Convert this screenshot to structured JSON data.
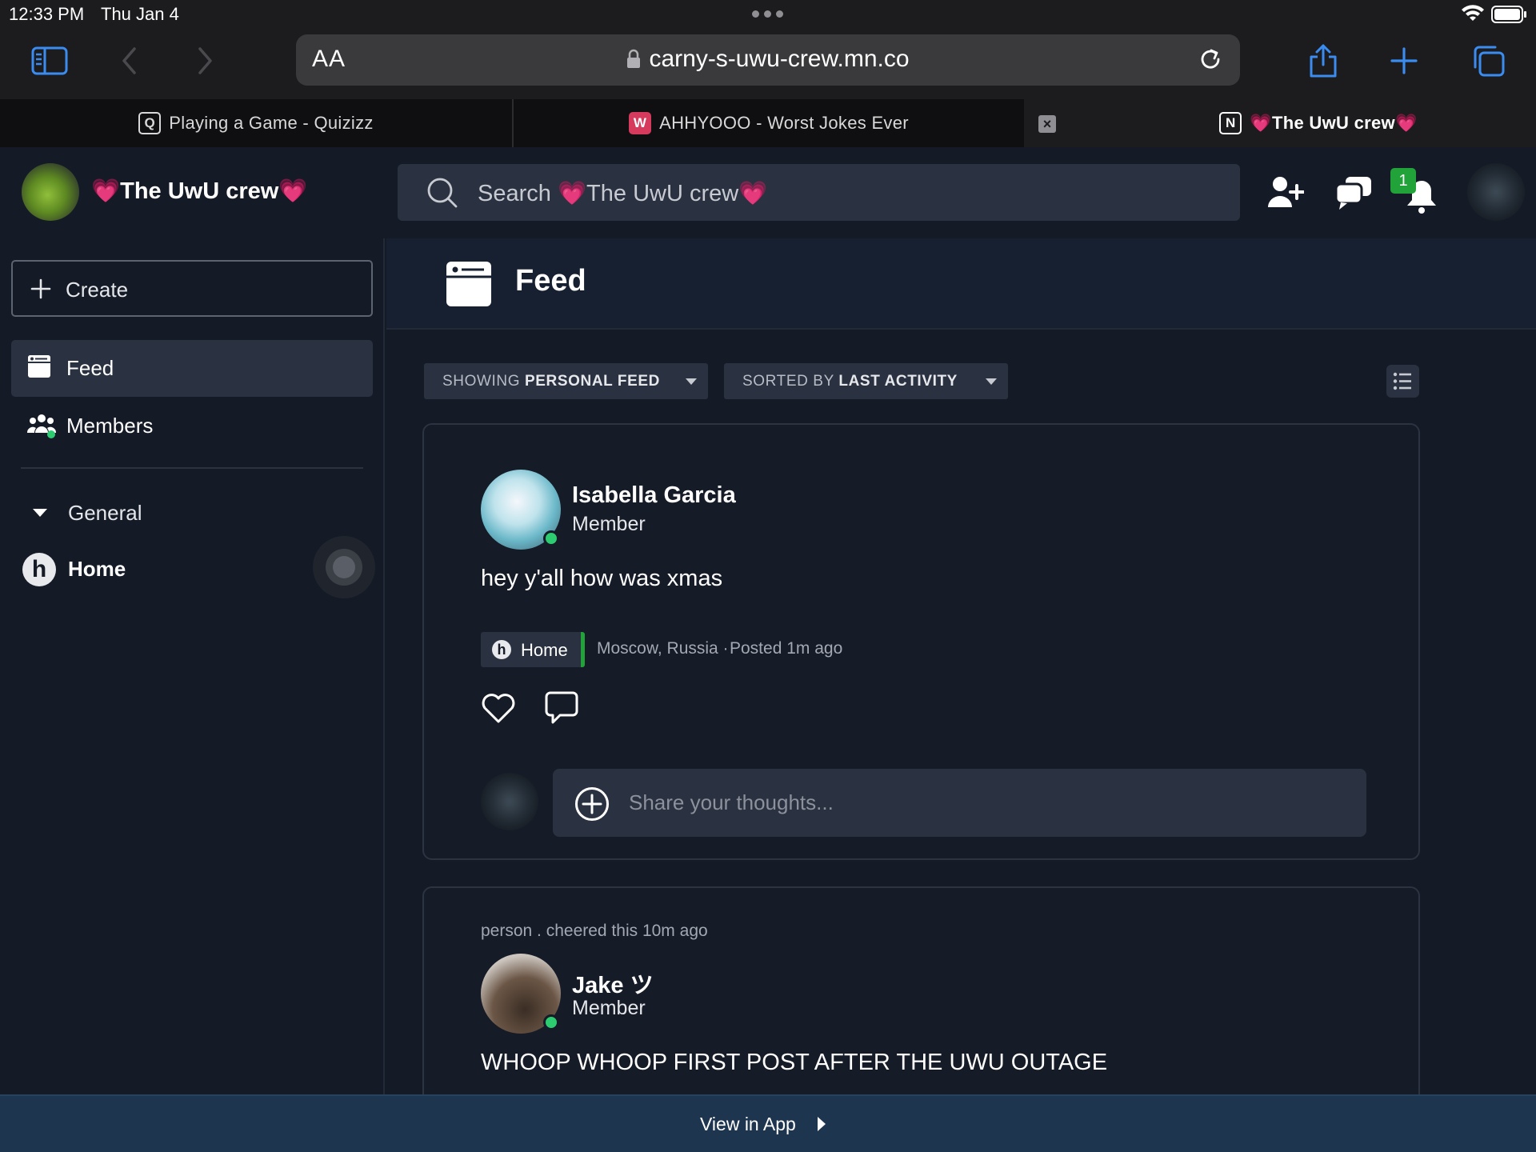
{
  "status_bar": {
    "time": "12:33 PM",
    "date": "Thu Jan 4"
  },
  "browser": {
    "text_size_label": "AA",
    "url": "carny-s-uwu-crew.mn.co",
    "tabs": [
      {
        "favicon": "Q",
        "title": "Playing a Game - Quizizz"
      },
      {
        "favicon": "W",
        "title": "AHHYOOO - Worst Jokes Ever"
      },
      {
        "favicon": "N",
        "title": "💗The UwU crew💗"
      }
    ]
  },
  "header": {
    "community_name": "💗The UwU crew💗",
    "search_placeholder": "Search 💗The UwU crew💗",
    "notification_count": "1"
  },
  "sidebar": {
    "create_label": "Create",
    "nav": [
      {
        "label": "Feed"
      },
      {
        "label": "Members"
      }
    ],
    "section_label": "General",
    "space_icon": "h",
    "space_label": "Home"
  },
  "main": {
    "title": "Feed",
    "filters": {
      "showing_prefix": "SHOWING",
      "showing_value": "PERSONAL FEED",
      "sorted_prefix": "SORTED BY",
      "sorted_value": "LAST ACTIVITY"
    },
    "posts": [
      {
        "author": "Isabella Garcia",
        "role": "Member",
        "body": "hey y'all how was xmas",
        "space_icon": "h",
        "space": "Home",
        "location": "Moscow, Russia ·",
        "posted": "Posted 1m ago",
        "comment_placeholder": "Share your thoughts..."
      },
      {
        "activity": "person . cheered this 10m ago",
        "author": "Jake ツ",
        "role": "Member",
        "body": "WHOOP WHOOP FIRST POST AFTER THE UWU OUTAGE"
      }
    ]
  },
  "banner": {
    "label": "View in App"
  },
  "colors": {
    "accent_blue": "#3b8cf0",
    "online_green": "#2ecc71",
    "space_green": "#21a33a",
    "banner_bg": "#1e3550"
  },
  "icons": [
    "sidebar-icon",
    "back-icon",
    "forward-icon",
    "lock-icon",
    "reload-icon",
    "share-icon",
    "new-tab-icon",
    "tabs-icon",
    "search-icon",
    "add-member-icon",
    "chat-icon",
    "bell-icon",
    "plus-icon",
    "feed-icon",
    "members-icon",
    "caret-down-icon",
    "list-view-icon",
    "heart-icon",
    "comment-icon",
    "add-circle-icon",
    "play-icon"
  ]
}
